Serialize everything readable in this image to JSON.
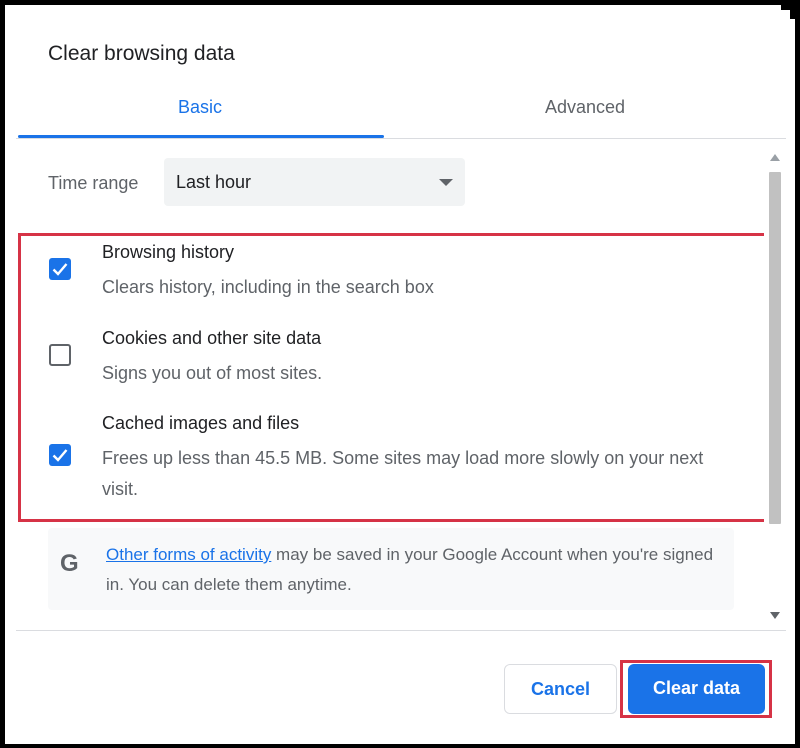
{
  "dialog": {
    "title": "Clear browsing data"
  },
  "tabs": [
    {
      "label": "Basic",
      "active": true
    },
    {
      "label": "Advanced",
      "active": false
    }
  ],
  "time_range": {
    "label": "Time range",
    "value": "Last hour"
  },
  "items": [
    {
      "title": "Browsing history",
      "description": "Clears history, including in the search box",
      "checked": true
    },
    {
      "title": "Cookies and other site data",
      "description": "Signs you out of most sites.",
      "checked": false
    },
    {
      "title": "Cached images and files",
      "description": "Frees up less than 45.5 MB. Some sites may load more slowly on your next visit.",
      "checked": true
    }
  ],
  "info": {
    "icon": "google-g-icon",
    "link_text": "Other forms of activity",
    "text": " may be saved in your Google Account when you're signed in. You can delete them anytime."
  },
  "buttons": {
    "cancel": "Cancel",
    "clear": "Clear data"
  },
  "colors": {
    "accent": "#1a73e8",
    "highlight": "#d63346"
  }
}
